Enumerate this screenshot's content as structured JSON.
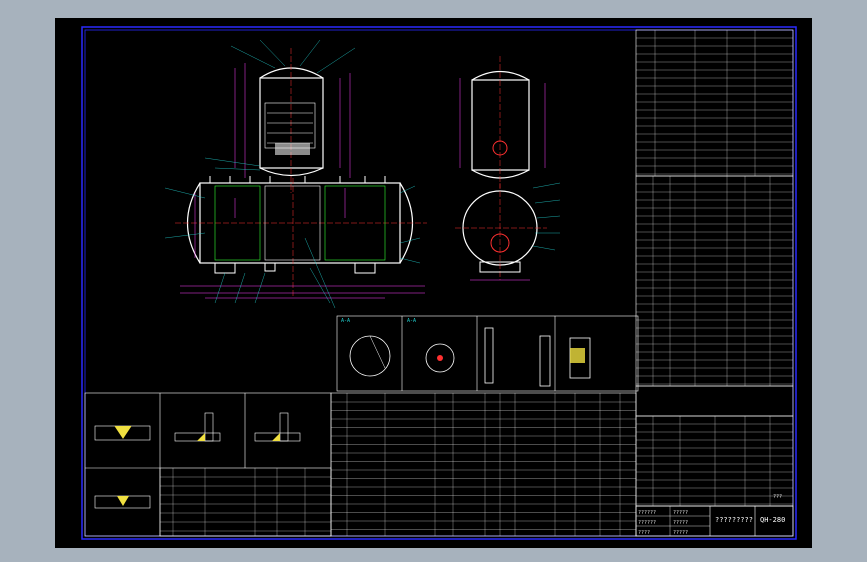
{
  "drawing": {
    "title": "?????????",
    "drawing_no": "QH-280",
    "sheet_mark": "???",
    "section_labels": [
      "A-A"
    ],
    "bottom_left_labels": [
      "??????",
      "??????",
      "????"
    ],
    "bottom_mid_labels": [
      "?????",
      "?????",
      "?????"
    ]
  },
  "colors": {
    "background": "#a7b2bd",
    "sheet": "#000000",
    "border": "#2a2aff",
    "vessel": "#ffffff",
    "dimension": "#ff40ff",
    "centerline": "#ff3030",
    "annotation": "#22d3d3",
    "text": "#ffffff",
    "highlight": "#f0e040"
  }
}
